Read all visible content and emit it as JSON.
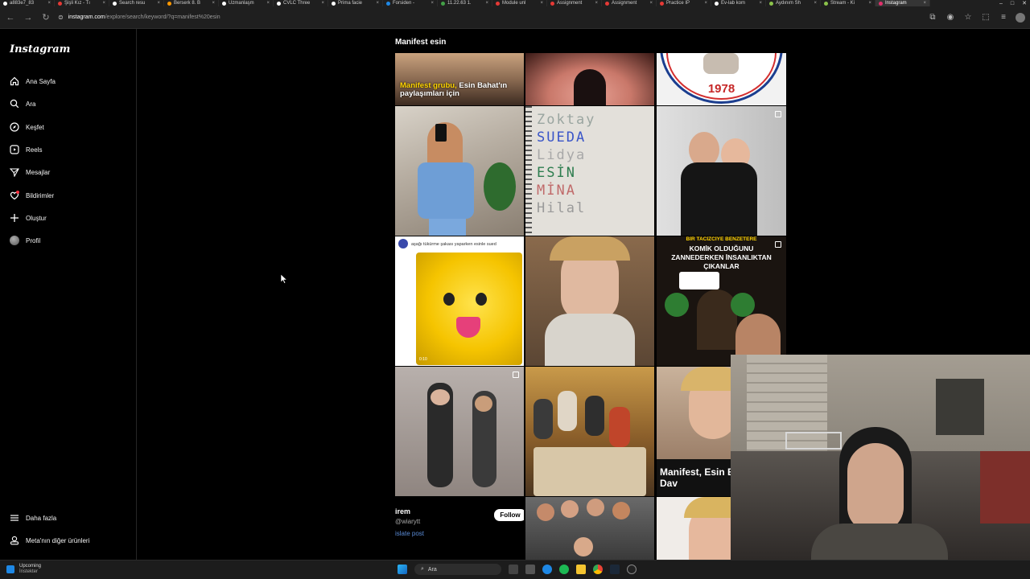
{
  "browser": {
    "tabs": [
      {
        "label": "a883e7_83",
        "color": "#ffffff"
      },
      {
        "label": "Şişli Kız - Tı",
        "color": "#e53935"
      },
      {
        "label": "Search resu",
        "color": "#ffffff"
      },
      {
        "label": "Berserk 8. B",
        "color": "#ff9800"
      },
      {
        "label": "Uzmanlaşm",
        "color": "#ffffff"
      },
      {
        "label": "CVLC Three",
        "color": "#ffffff"
      },
      {
        "label": "Prima facie",
        "color": "#ffffff"
      },
      {
        "label": "Forsiden - ",
        "color": "#1e88e5"
      },
      {
        "label": "11.22.63 1.",
        "color": "#43a047"
      },
      {
        "label": "Module unl",
        "color": "#e53935"
      },
      {
        "label": "Assignment",
        "color": "#e53935"
      },
      {
        "label": "Assignment",
        "color": "#e53935"
      },
      {
        "label": "Practice IP ",
        "color": "#e53935"
      },
      {
        "label": "Ev-lab kom",
        "color": "#ffffff"
      },
      {
        "label": "Aydınım Sh",
        "color": "#8bc34a"
      },
      {
        "label": "Stream - Ki",
        "color": "#8bc34a"
      },
      {
        "label": "Instagram",
        "color": "#e1306c",
        "active": true
      }
    ],
    "url_domain": "instagram.com",
    "url_rest": "/explore/search/keyword/?q=manifest%20esin"
  },
  "sidebar": {
    "logo": "Instagram",
    "items": [
      {
        "label": "Ana Sayfa",
        "icon": "home-icon"
      },
      {
        "label": "Ara",
        "icon": "search-icon"
      },
      {
        "label": "Keşfet",
        "icon": "compass-icon"
      },
      {
        "label": "Reels",
        "icon": "reels-icon"
      },
      {
        "label": "Mesajlar",
        "icon": "messages-icon"
      },
      {
        "label": "Bildirimler",
        "icon": "heart-icon"
      },
      {
        "label": "Oluştur",
        "icon": "plus-icon"
      },
      {
        "label": "Profil",
        "icon": "avatar"
      }
    ],
    "more_label": "Daha fazla",
    "meta_label": "Meta'nın diğer ürünleri"
  },
  "explore": {
    "title": "Manifest esin",
    "post1_caption_yellow": "Manifest grubu,",
    "post1_caption_white": " Esin Bahat'ın paylaşımları için",
    "post3_year": "1978",
    "post5_lines": [
      "Zoktay",
      "SUEDA",
      "Lidya",
      "ESİN",
      "MİNA",
      "Hilal"
    ],
    "post7_header": "aşağı tükürme şakası yaparken esinle sued",
    "post7_time": "0:10",
    "post9_caption": "KOMİK OLDUĞUNU ZANNEDERKEN İNSANLIKTAN ÇIKANLAR",
    "post9_top": "BİR TACİZCİYE BENZETERE",
    "post12_caption": "Manifest, Esin Edenlere Dav",
    "suggest_name": "irem",
    "suggest_handle": "@wiarytt",
    "suggest_follow": "Follow",
    "suggest_link": "islate post"
  },
  "taskbar": {
    "widget_title": "Upcoming",
    "widget_sub": "İnstekter",
    "search_placeholder": "Ara"
  }
}
